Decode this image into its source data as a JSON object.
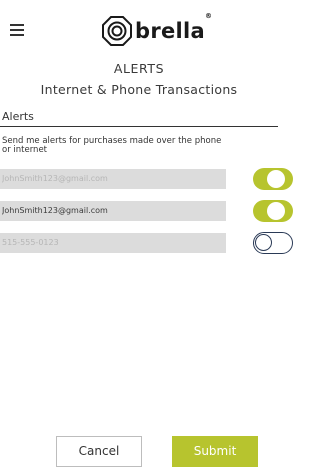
{
  "header": {
    "brand": "brella",
    "brand_tm": "®"
  },
  "page": {
    "title": "ALERTS",
    "subtitle": "Internet & Phone Transactions"
  },
  "section": {
    "heading": "Alerts",
    "description": "Send me alerts for purchases made over the phone or internet"
  },
  "contacts": [
    {
      "value": "JohnSmith123@gmail.com",
      "enabled": true
    },
    {
      "value": "JohnSmith123@gmail.com",
      "enabled": true
    },
    {
      "value": "515-555-0123",
      "enabled": false
    }
  ],
  "actions": {
    "cancel_label": "Cancel",
    "submit_label": "Submit"
  },
  "colors": {
    "accent": "#b7c42e",
    "toggle_off_border": "#2a3a56",
    "field_bg": "#dcdcdc"
  },
  "icons": {
    "menu": "hamburger-menu-icon",
    "logo": "brella-logo-icon"
  }
}
